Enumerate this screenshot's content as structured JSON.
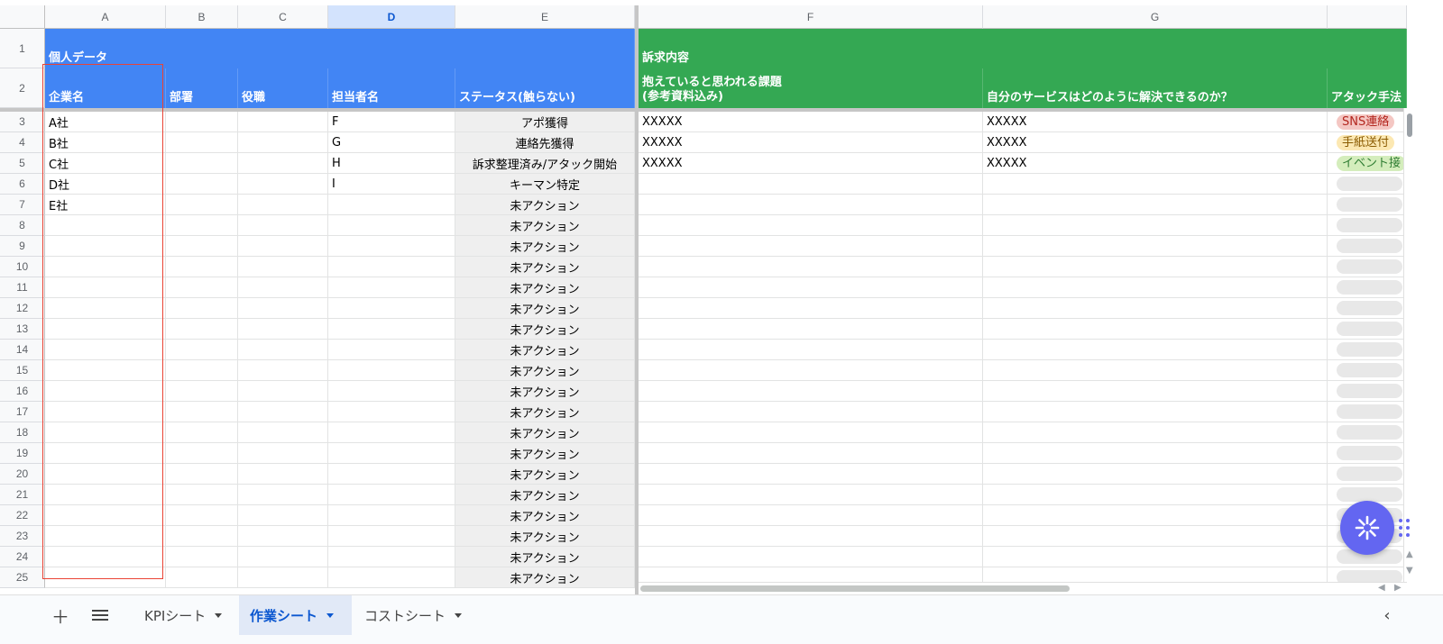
{
  "columns": [
    {
      "letter": "A",
      "selected": false
    },
    {
      "letter": "B",
      "selected": false
    },
    {
      "letter": "C",
      "selected": false
    },
    {
      "letter": "D",
      "selected": true
    },
    {
      "letter": "E",
      "selected": false
    },
    {
      "letter": "F",
      "selected": false
    },
    {
      "letter": "G",
      "selected": false
    },
    {
      "letter": "",
      "selected": false
    }
  ],
  "row_numbers": [
    "1",
    "2",
    "3",
    "4",
    "5",
    "6",
    "7",
    "8",
    "9",
    "10",
    "11",
    "12",
    "13",
    "14",
    "15",
    "16",
    "17",
    "18",
    "19",
    "20",
    "21",
    "22",
    "23",
    "24",
    "25"
  ],
  "header": {
    "group_personal": "個人データ",
    "group_appeal": "訴求内容",
    "company": "企業名",
    "department": "部署",
    "position": "役職",
    "contact": "担当者名",
    "status": "ステータス(触らない)",
    "issues": "抱えていると思われる課題\n(参考資料込み)",
    "solution": "自分のサービスはどのように解決できるのか？",
    "attack": "アタック手法"
  },
  "colors": {
    "personal_header": "#4285f4",
    "appeal_header": "#34a853",
    "status_bg": "#efefef",
    "highlight_box": "#ea4335",
    "fab": "#6366f1"
  },
  "rows": [
    {
      "company": "A社",
      "contact": "F",
      "status": "アポ獲得",
      "issues": "XXXXX",
      "solution": "XXXXX",
      "attack": "SNS連絡",
      "attack_color": "#f4c7c3",
      "attack_text_color": "#b3261e"
    },
    {
      "company": "B社",
      "contact": "G",
      "status": "連絡先獲得",
      "issues": "XXXXX",
      "solution": "XXXXX",
      "attack": "手紙送付",
      "attack_color": "#fce8b2",
      "attack_text_color": "#8a5a00"
    },
    {
      "company": "C社",
      "contact": "H",
      "status": "訴求整理済み/アタック開始",
      "issues": "XXXXX",
      "solution": "XXXXX",
      "attack": "イベント接",
      "attack_color": "#d4edbc",
      "attack_text_color": "#2e7d32"
    },
    {
      "company": "D社",
      "contact": "I",
      "status": "キーマン特定",
      "issues": "",
      "solution": "",
      "attack": "",
      "attack_color": "",
      "attack_text_color": ""
    },
    {
      "company": "E社",
      "contact": "",
      "status": "未アクション",
      "issues": "",
      "solution": "",
      "attack": "",
      "attack_color": "",
      "attack_text_color": ""
    },
    {
      "company": "",
      "contact": "",
      "status": "未アクション",
      "issues": "",
      "solution": "",
      "attack": ""
    },
    {
      "company": "",
      "contact": "",
      "status": "未アクション",
      "issues": "",
      "solution": "",
      "attack": ""
    },
    {
      "company": "",
      "contact": "",
      "status": "未アクション",
      "issues": "",
      "solution": "",
      "attack": ""
    },
    {
      "company": "",
      "contact": "",
      "status": "未アクション",
      "issues": "",
      "solution": "",
      "attack": ""
    },
    {
      "company": "",
      "contact": "",
      "status": "未アクション",
      "issues": "",
      "solution": "",
      "attack": ""
    },
    {
      "company": "",
      "contact": "",
      "status": "未アクション",
      "issues": "",
      "solution": "",
      "attack": ""
    },
    {
      "company": "",
      "contact": "",
      "status": "未アクション",
      "issues": "",
      "solution": "",
      "attack": ""
    },
    {
      "company": "",
      "contact": "",
      "status": "未アクション",
      "issues": "",
      "solution": "",
      "attack": ""
    },
    {
      "company": "",
      "contact": "",
      "status": "未アクション",
      "issues": "",
      "solution": "",
      "attack": ""
    },
    {
      "company": "",
      "contact": "",
      "status": "未アクション",
      "issues": "",
      "solution": "",
      "attack": ""
    },
    {
      "company": "",
      "contact": "",
      "status": "未アクション",
      "issues": "",
      "solution": "",
      "attack": ""
    },
    {
      "company": "",
      "contact": "",
      "status": "未アクション",
      "issues": "",
      "solution": "",
      "attack": ""
    },
    {
      "company": "",
      "contact": "",
      "status": "未アクション",
      "issues": "",
      "solution": "",
      "attack": ""
    },
    {
      "company": "",
      "contact": "",
      "status": "未アクション",
      "issues": "",
      "solution": "",
      "attack": ""
    },
    {
      "company": "",
      "contact": "",
      "status": "未アクション",
      "issues": "",
      "solution": "",
      "attack": ""
    },
    {
      "company": "",
      "contact": "",
      "status": "未アクション",
      "issues": "",
      "solution": "",
      "attack": ""
    },
    {
      "company": "",
      "contact": "",
      "status": "未アクション",
      "issues": "",
      "solution": "",
      "attack": ""
    },
    {
      "company": "",
      "contact": "",
      "status": "未アクション",
      "issues": "",
      "solution": "",
      "attack": ""
    }
  ],
  "tabs": [
    {
      "label": "KPIシート",
      "active": false
    },
    {
      "label": "作業シート",
      "active": true
    },
    {
      "label": "コストシート",
      "active": false
    }
  ],
  "icons": {
    "add_sheet": "plus-icon",
    "all_sheets": "menu-icon",
    "fab": "asterisk-burst-icon",
    "collapse": "chevron-left-icon"
  }
}
